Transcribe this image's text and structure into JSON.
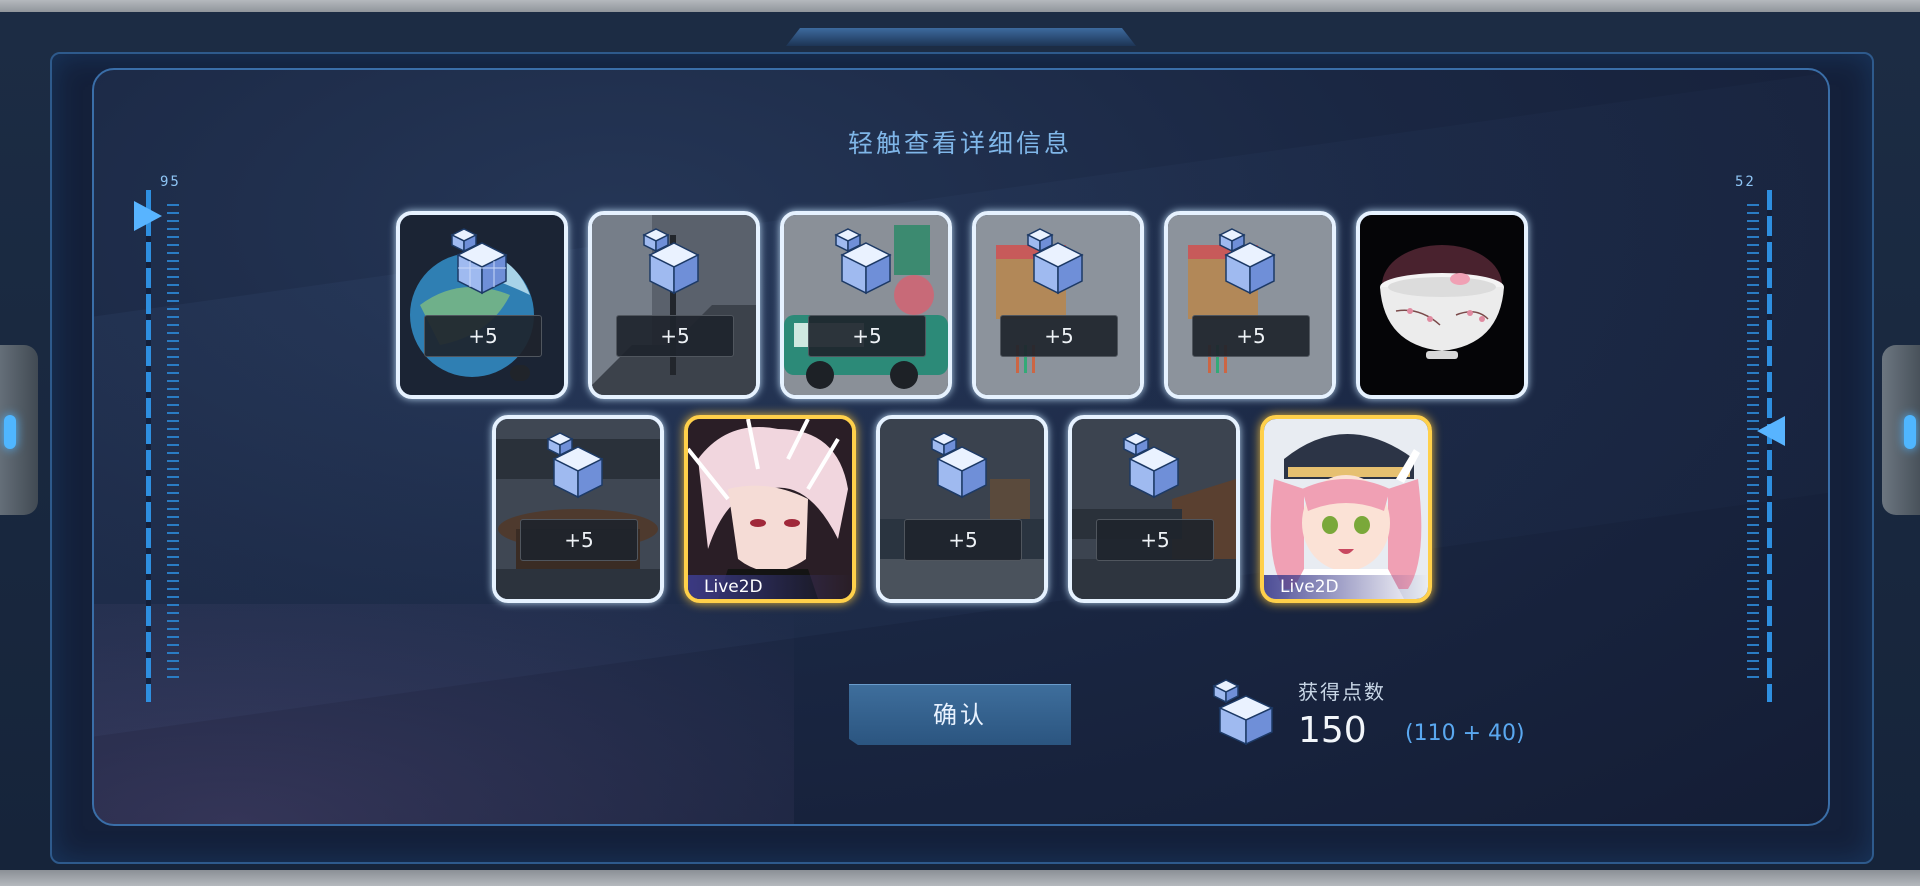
{
  "header": {
    "title": "轻触查看详细信息"
  },
  "gauges": {
    "left_value": "95",
    "right_value": "52"
  },
  "rewards": [
    {
      "type": "furniture",
      "bonus": "+5",
      "scene": "globe"
    },
    {
      "type": "furniture",
      "bonus": "+5",
      "scene": "stairs"
    },
    {
      "type": "furniture",
      "bonus": "+5",
      "scene": "van"
    },
    {
      "type": "furniture",
      "bonus": "+5",
      "scene": "stall"
    },
    {
      "type": "furniture",
      "bonus": "+5",
      "scene": "stall"
    },
    {
      "type": "item",
      "scene": "porcelain-bowl"
    },
    {
      "type": "furniture",
      "bonus": "+5",
      "scene": "room"
    },
    {
      "type": "character",
      "badge": "Live2D",
      "scene": "white-hair"
    },
    {
      "type": "furniture",
      "bonus": "+5",
      "scene": "room"
    },
    {
      "type": "furniture",
      "bonus": "+5",
      "scene": "room"
    },
    {
      "type": "character",
      "badge": "Live2D",
      "scene": "pink-hair"
    }
  ],
  "actions": {
    "confirm_label": "确认"
  },
  "points": {
    "label": "获得点数",
    "value": "150",
    "breakdown": "(110 + 40)"
  },
  "colors": {
    "accent": "#58b4ff",
    "gold_frame": "#ffd04a",
    "panel": "#1a2743"
  }
}
